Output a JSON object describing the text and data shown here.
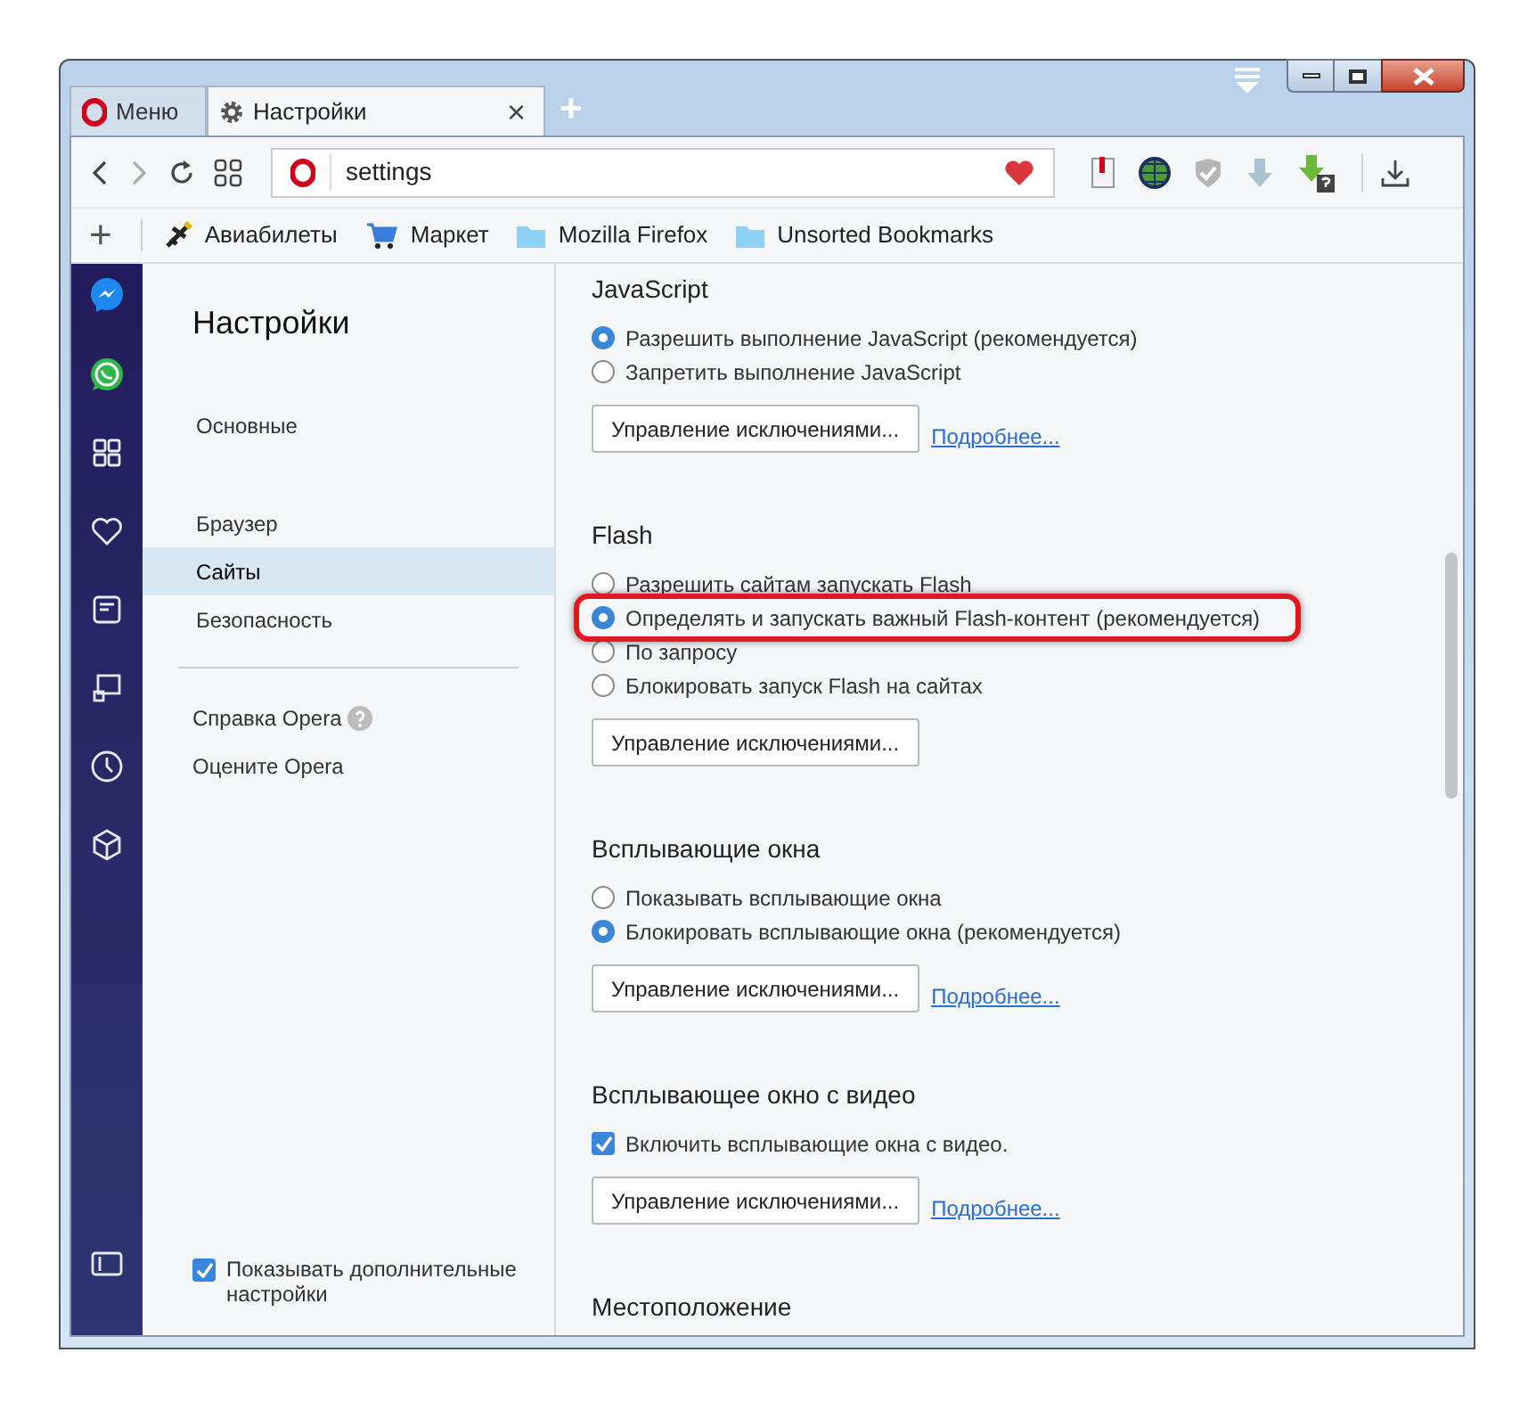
{
  "tabs": [
    {
      "kind": "menu",
      "label": "Меню",
      "selected": false
    },
    {
      "kind": "page",
      "label": "Настройки",
      "selected": true,
      "close": "×"
    }
  ],
  "new_tab": "+",
  "address_bar": {
    "value": "settings"
  },
  "bookmarks_bar": {
    "add": "+",
    "items": [
      {
        "kind": "plane",
        "label": "Авиабилеты"
      },
      {
        "kind": "cart",
        "label": "Маркет"
      },
      {
        "kind": "folder",
        "label": "Mozilla Firefox"
      },
      {
        "kind": "folder",
        "label": "Unsorted Bookmarks"
      }
    ]
  },
  "settings_nav": {
    "title": "Настройки",
    "groups": [
      [
        {
          "label": "Основные",
          "selected": false
        }
      ],
      [
        {
          "label": "Браузер",
          "selected": false
        },
        {
          "label": "Сайты",
          "selected": true
        },
        {
          "label": "Безопасность",
          "selected": false
        }
      ]
    ],
    "links": [
      {
        "label": "Справка Opera",
        "help": true
      },
      {
        "label": "Оцените Opera",
        "help": false
      }
    ],
    "advanced": {
      "label": "Показывать дополнительные настройки",
      "checked": true
    }
  },
  "sections": [
    {
      "title": "JavaScript",
      "options": [
        {
          "kind": "radio",
          "label": "Разрешить выполнение JavaScript (рекомендуется)",
          "selected": true,
          "highlighted": false
        },
        {
          "kind": "radio",
          "label": "Запретить выполнение JavaScript",
          "selected": false,
          "highlighted": false
        }
      ],
      "button": "Управление исключениями...",
      "link": "Подробнее..."
    },
    {
      "title": "Flash",
      "options": [
        {
          "kind": "radio",
          "label": "Разрешить сайтам запускать Flash",
          "selected": false,
          "highlighted": false
        },
        {
          "kind": "radio",
          "label": "Определять и запускать важный Flash-контент (рекомендуется)",
          "selected": true,
          "highlighted": true
        },
        {
          "kind": "radio",
          "label": "По запросу",
          "selected": false,
          "highlighted": false
        },
        {
          "kind": "radio",
          "label": "Блокировать запуск Flash на сайтах",
          "selected": false,
          "highlighted": false
        }
      ],
      "button": "Управление исключениями..."
    },
    {
      "title": "Всплывающие окна",
      "options": [
        {
          "kind": "radio",
          "label": "Показывать всплывающие окна",
          "selected": false,
          "highlighted": false
        },
        {
          "kind": "radio",
          "label": "Блокировать всплывающие окна (рекомендуется)",
          "selected": true,
          "highlighted": false
        }
      ],
      "button": "Управление исключениями...",
      "link": "Подробнее..."
    },
    {
      "title": "Всплывающее окно с видео",
      "options": [
        {
          "kind": "checkbox",
          "label": "Включить всплывающие окна с видео.",
          "checked": true,
          "highlighted": false
        }
      ],
      "button": "Управление исключениями...",
      "link": "Подробнее..."
    },
    {
      "title": "Местоположение"
    }
  ]
}
